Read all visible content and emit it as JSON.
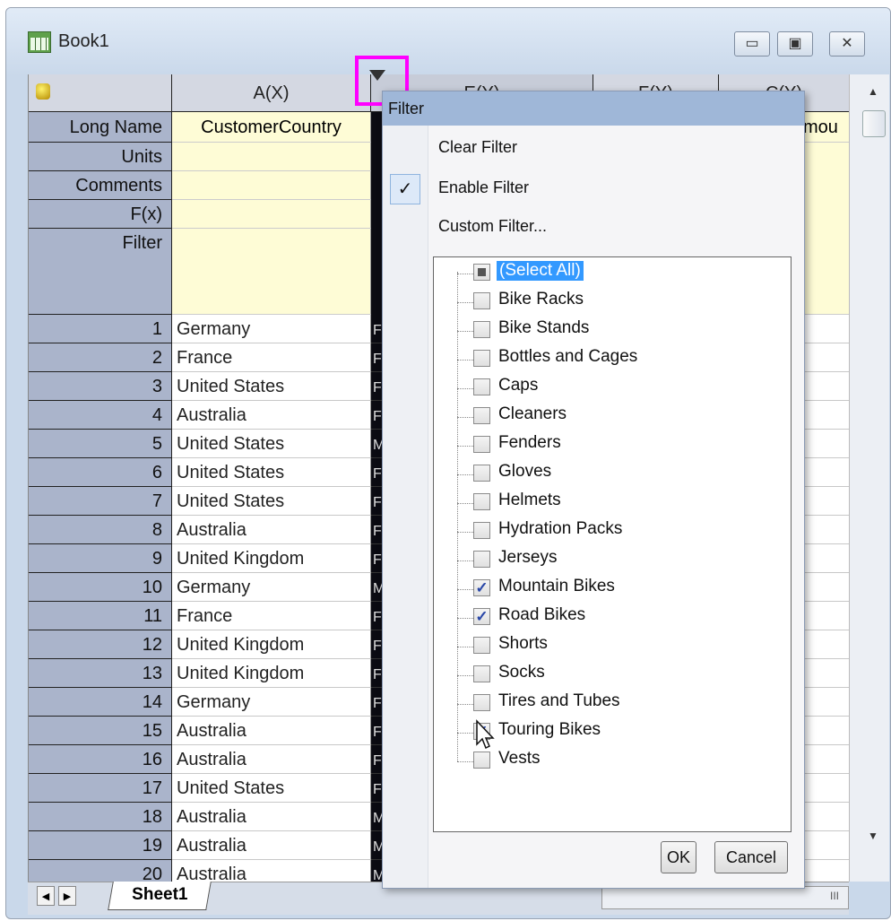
{
  "window": {
    "title": "Book1",
    "min_label": "▭",
    "max_label": "▣",
    "close_label": "✕"
  },
  "columns": {
    "a_label": "A(X)",
    "e_label": "E(Y)",
    "f_label": "F(Y)",
    "c_label": "C(Y)"
  },
  "meta": {
    "long_name": "Long Name",
    "units": "Units",
    "comments": "Comments",
    "fx": "F(x)",
    "filter": "Filter",
    "a_long_name": "CustomerCountry",
    "c_long_name_partial": "mou"
  },
  "rows": [
    {
      "n": "1",
      "country": "Germany",
      "e": "F"
    },
    {
      "n": "2",
      "country": "France",
      "e": "F"
    },
    {
      "n": "3",
      "country": "United States",
      "e": "F"
    },
    {
      "n": "4",
      "country": "Australia",
      "e": "F"
    },
    {
      "n": "5",
      "country": "United States",
      "e": "M"
    },
    {
      "n": "6",
      "country": "United States",
      "e": "F"
    },
    {
      "n": "7",
      "country": "United States",
      "e": "F"
    },
    {
      "n": "8",
      "country": "Australia",
      "e": "F"
    },
    {
      "n": "9",
      "country": "United Kingdom",
      "e": "F"
    },
    {
      "n": "10",
      "country": "Germany",
      "e": "M"
    },
    {
      "n": "11",
      "country": "France",
      "e": "F"
    },
    {
      "n": "12",
      "country": "United Kingdom",
      "e": "F"
    },
    {
      "n": "13",
      "country": "United Kingdom",
      "e": "F"
    },
    {
      "n": "14",
      "country": "Germany",
      "e": "F"
    },
    {
      "n": "15",
      "country": "Australia",
      "e": "F"
    },
    {
      "n": "16",
      "country": "Australia",
      "e": "F"
    },
    {
      "n": "17",
      "country": "United States",
      "e": "F"
    },
    {
      "n": "18",
      "country": "Australia",
      "e": "M"
    },
    {
      "n": "19",
      "country": "Australia",
      "e": "M"
    },
    {
      "n": "20",
      "country": "Australia",
      "e": "M"
    }
  ],
  "sheet_tab": "Sheet1",
  "hscroll_label": "III",
  "filter_dialog": {
    "title": "Filter",
    "clear_filter": "Clear Filter",
    "enable_filter": "Enable Filter",
    "enable_check": "✓",
    "custom_filter": "Custom Filter...",
    "ok": "OK",
    "cancel": "Cancel",
    "items": [
      {
        "label": "(Select All)",
        "check": ""
      },
      {
        "label": "Bike Racks",
        "check": ""
      },
      {
        "label": "Bike Stands",
        "check": ""
      },
      {
        "label": "Bottles and Cages",
        "check": ""
      },
      {
        "label": "Caps",
        "check": ""
      },
      {
        "label": "Cleaners",
        "check": ""
      },
      {
        "label": "Fenders",
        "check": ""
      },
      {
        "label": "Gloves",
        "check": ""
      },
      {
        "label": "Helmets",
        "check": ""
      },
      {
        "label": "Hydration Packs",
        "check": ""
      },
      {
        "label": "Jerseys",
        "check": ""
      },
      {
        "label": "Mountain Bikes",
        "check": "✓"
      },
      {
        "label": "Road Bikes",
        "check": "✓"
      },
      {
        "label": "Shorts",
        "check": ""
      },
      {
        "label": "Socks",
        "check": ""
      },
      {
        "label": "Tires and Tubes",
        "check": ""
      },
      {
        "label": "Touring Bikes",
        "check": "✓"
      },
      {
        "label": "Vests",
        "check": ""
      }
    ]
  }
}
